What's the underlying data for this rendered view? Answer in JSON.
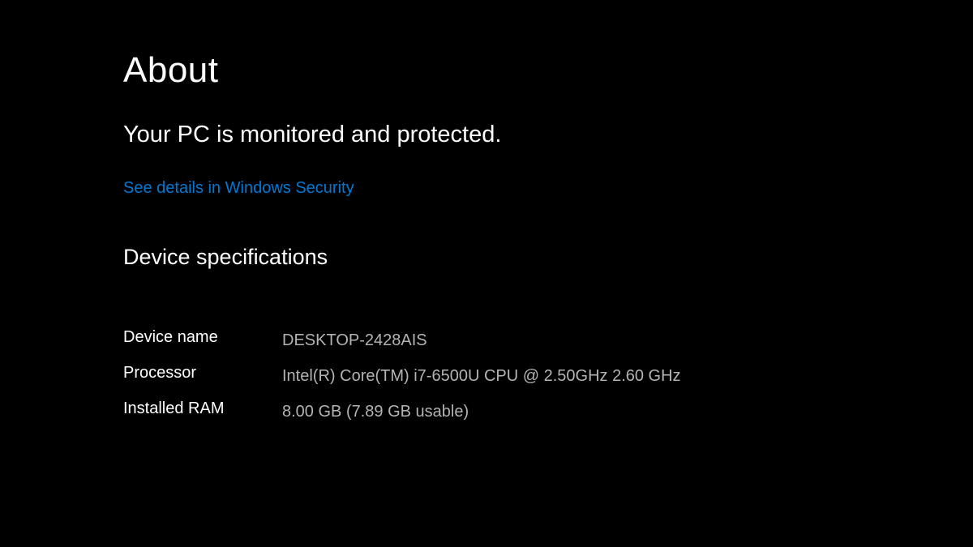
{
  "page": {
    "title": "About",
    "status_heading": "Your PC is monitored and protected.",
    "security_link": "See details in Windows Security"
  },
  "device_specs": {
    "heading": "Device specifications",
    "rows": [
      {
        "label": "Device name",
        "value": "DESKTOP-2428AIS"
      },
      {
        "label": "Processor",
        "value": "Intel(R) Core(TM) i7-6500U CPU @ 2.50GHz   2.60 GHz"
      },
      {
        "label": "Installed RAM",
        "value": "8.00 GB (7.89 GB usable)"
      }
    ]
  }
}
